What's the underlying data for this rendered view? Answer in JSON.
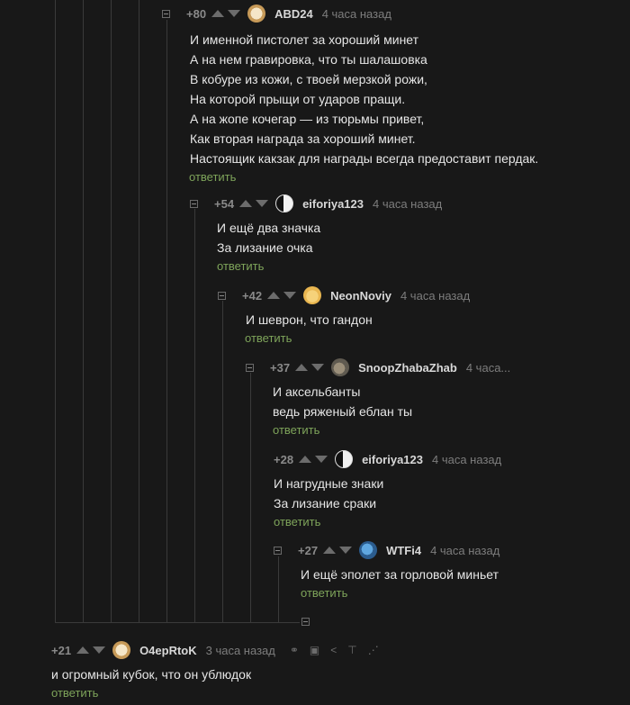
{
  "comments": [
    {
      "rating": "+80",
      "author": "ABD24",
      "time": "4 часа назад",
      "lines": [
        "И именной пистолет за хороший минет",
        "А на нем гравировка, что ты шалашовка",
        "В кобуре из кожи, с твоей мерзкой рожи,",
        "На которой прыщи от ударов пращи.",
        "А на жопе кочегар — из тюрьмы привет,",
        "Как вторая награда за хороший минет.",
        "Настоящик какзак для награды всегда предоставит пердак."
      ],
      "reply": "ответить",
      "avatar_icon": "avatar-bear-icon"
    },
    {
      "rating": "+54",
      "author": "eiforiya123",
      "time": "4 часа назад",
      "lines": [
        "И ещё два значка",
        "За лизание очка"
      ],
      "reply": "ответить",
      "avatar_icon": "avatar-bw-icon"
    },
    {
      "rating": "+42",
      "author": "NeonNoviy",
      "time": "4 часа назад",
      "lines": [
        "И шеврон, что гандон"
      ],
      "reply": "ответить",
      "avatar_icon": "avatar-yellow-icon"
    },
    {
      "rating": "+37",
      "author": "SnoopZhabaZhab",
      "time": "4 часа...",
      "lines": [
        "И аксельбанты",
        "ведь ряженый еблан ты"
      ],
      "reply": "ответить",
      "avatar_icon": "avatar-animal-icon"
    },
    {
      "rating": "+28",
      "author": "eiforiya123",
      "time": "4 часа назад",
      "lines": [
        "И нагрудные знаки",
        "За лизание сраки"
      ],
      "reply": "ответить",
      "avatar_icon": "avatar-bw-icon"
    },
    {
      "rating": "+27",
      "author": "WTFi4",
      "time": "4 часа назад",
      "lines": [
        "И ещё эполет за горловой миньет"
      ],
      "reply": "ответить",
      "avatar_icon": "avatar-globe-icon"
    },
    {
      "rating": "+21",
      "author": "O4epRtoK",
      "time": "3 часа назад",
      "lines": [
        "и огромный кубок, что он ублюдок"
      ],
      "reply": "ответить",
      "avatar_icon": "avatar-bear-icon",
      "action_icons": [
        "link-icon",
        "save-icon",
        "share-icon",
        "pin-icon",
        "more-icon"
      ]
    }
  ],
  "colors": {
    "background": "#181818",
    "reply": "#7ea45a",
    "muted": "#7d7d7d",
    "thread_line": "#3a3a3a"
  }
}
